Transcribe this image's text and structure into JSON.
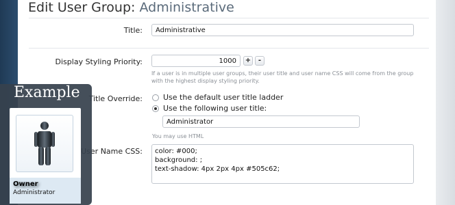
{
  "header": {
    "title_prefix": "Edit User Group:",
    "group_name": "Administrative"
  },
  "fields": {
    "title": {
      "label": "Title:",
      "value": "Administrative"
    },
    "priority": {
      "label": "Display Styling Priority:",
      "value": "1000",
      "increment_label": "+",
      "decrement_label": "-",
      "hint_line1": "If a user is in multiple user groups, their user title and user name CSS will come from the group",
      "hint_line2": "with the highest display styling priority."
    },
    "title_override": {
      "label": "Title Override:",
      "option_default": "Use the default user title ladder",
      "option_custom": "Use the following user title:",
      "selected": "custom",
      "custom_value": "Administrator",
      "hint": "You may use HTML"
    },
    "css": {
      "label": "User Name CSS:",
      "lines": [
        "color: #000;",
        "background: ;",
        "text-shadow: 4px 2px 4px #505c62;"
      ]
    }
  },
  "example": {
    "heading": "Example",
    "name": "Owner",
    "role": "Administrator",
    "icon": "person-icon"
  },
  "colors": {
    "sidebar": "#2c4d6e",
    "overlay": "#37424e",
    "name_shadow": "#505c62"
  }
}
